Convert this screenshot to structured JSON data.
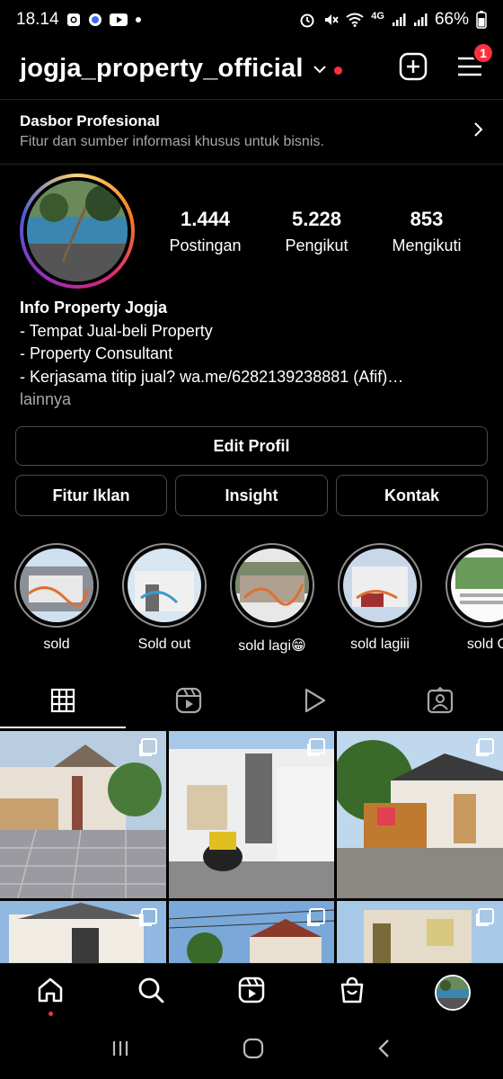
{
  "status_bar": {
    "time": "18.14",
    "network": "4G",
    "battery": "66%",
    "icons_left": [
      "instagram-notif-icon",
      "browser-notif-icon",
      "youtube-icon",
      "dot-icon"
    ],
    "icons_right": [
      "alarm-icon",
      "mute-icon",
      "wifi-icon",
      "signal-icon",
      "signal-icon-2"
    ]
  },
  "header": {
    "username": "jogja_property_official",
    "notification_count": "1",
    "accent": "#ff3040"
  },
  "dashboard": {
    "title": "Dasbor Profesional",
    "subtitle": "Fitur dan sumber informasi khusus untuk bisnis."
  },
  "profile": {
    "stats": [
      {
        "value": "1.444",
        "label": "Postingan"
      },
      {
        "value": "5.228",
        "label": "Pengikut"
      },
      {
        "value": "853",
        "label": "Mengikuti"
      }
    ]
  },
  "bio": {
    "name": "Info Property Jogja",
    "lines": [
      "- Tempat Jual-beli Property",
      "- Property Consultant",
      "- Kerjasama titip jual? wa.me/6282139238881 (Afif)…"
    ],
    "more": "lainnya"
  },
  "buttons": {
    "edit_profile": "Edit Profil",
    "ad_tools": "Fitur Iklan",
    "insights": "Insight",
    "contact": "Kontak"
  },
  "highlights": [
    {
      "label": "sold"
    },
    {
      "label": "Sold out"
    },
    {
      "label": "sold lagi😁"
    },
    {
      "label": "sold lagiii"
    },
    {
      "label": "sold O"
    }
  ],
  "tabs": [
    "grid-icon",
    "reels-icon",
    "video-icon",
    "tagged-icon"
  ],
  "bottom_nav": [
    "home-icon",
    "search-icon",
    "reels-icon",
    "shop-icon",
    "profile-avatar"
  ]
}
